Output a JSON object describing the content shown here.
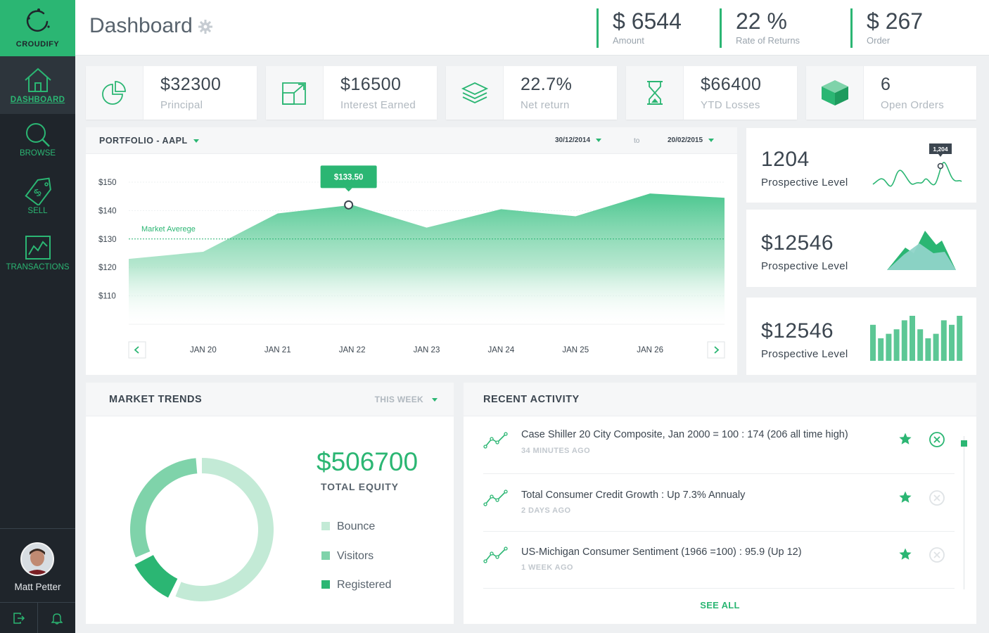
{
  "app": {
    "brand": "CROUDIFY"
  },
  "sidebar": {
    "items": [
      {
        "label": "DASHBOARD",
        "icon": "home-icon",
        "active": true
      },
      {
        "label": "BROWSE",
        "icon": "search-icon"
      },
      {
        "label": "SELL",
        "icon": "dollar-tag-icon"
      },
      {
        "label": "TRANSACTIONS",
        "icon": "chart-icon"
      }
    ],
    "user": {
      "name": "Matt Petter"
    }
  },
  "header": {
    "title": "Dashboard",
    "stats": [
      {
        "value": "$ 6544",
        "label": "Amount"
      },
      {
        "value": "22 %",
        "label": "Rate of Returns"
      },
      {
        "value": "$ 267",
        "label": "Order"
      }
    ]
  },
  "stat_cards": [
    {
      "value": "$32300",
      "label": "Principal",
      "icon": "pie-chart-icon"
    },
    {
      "value": "$16500",
      "label": "Interest Earned",
      "icon": "expand-arrow-icon"
    },
    {
      "value": "22.7%",
      "label": "Net return",
      "icon": "layers-icon"
    },
    {
      "value": "$66400",
      "label": "YTD Losses",
      "icon": "hourglass-icon"
    },
    {
      "value": "6",
      "label": "Open Orders",
      "icon": "box-icon"
    }
  ],
  "portfolio": {
    "title": "PORTFOLIO - AAPL",
    "date_from": "30/12/2014",
    "date_to_label": "to",
    "date_to": "20/02/2015",
    "market_average_label": "Market Averege",
    "tooltip": "$133.50"
  },
  "mini_cards": [
    {
      "value": "1204",
      "label": "Prospective Level",
      "badge": "1,204"
    },
    {
      "value": "$12546",
      "label": "Prospective Level"
    },
    {
      "value": "$12546",
      "label": "Prospective Level",
      "bars": [
        8,
        5,
        6,
        7,
        9,
        10,
        7,
        5,
        6,
        9,
        8,
        10
      ]
    }
  ],
  "market_trends": {
    "title": "MARKET TRENDS",
    "filter": "THIS WEEK",
    "equity_value": "$506700",
    "equity_label": "TOTAL EQUITY",
    "legend": [
      {
        "label": "Bounce",
        "color": "#c3ead6"
      },
      {
        "label": "Visitors",
        "color": "#7fd3aa"
      },
      {
        "label": "Registered",
        "color": "#2bb673"
      }
    ],
    "donut": [
      {
        "label": "Bounce",
        "value": 56
      },
      {
        "label": "Registered",
        "value": 10
      },
      {
        "label": "Visitors",
        "value": 30
      }
    ]
  },
  "recent_activity": {
    "title": "RECENT ACTIVITY",
    "items": [
      {
        "text": "Case Shiller 20 City Composite, Jan 2000 = 100 :    174 (206 all time high)",
        "time": "34 MINUTES AGO"
      },
      {
        "text": "Total Consumer Credit Growth :    Up 7.3% Annualy",
        "time": "2 DAYS AGO"
      },
      {
        "text": "US-Michigan Consumer Sentiment (1966 =100) :    95.9 (Up 12)",
        "time": "1 WEEK AGO"
      }
    ],
    "see_all": "SEE ALL"
  },
  "colors": {
    "accent": "#2bb673",
    "sidebar": "#1f252b",
    "light_green": "#c3ead6"
  },
  "chart_data": {
    "type": "area",
    "categories": [
      "",
      "JAN 20",
      "JAN 21",
      "JAN 22",
      "JAN 23",
      "JAN 24",
      "JAN 25",
      "JAN 26",
      ""
    ],
    "values": [
      123,
      125.5,
      139,
      142,
      134,
      140.5,
      138,
      146,
      144.5
    ],
    "y_ticks": [
      "$150",
      "$140",
      "$130",
      "$120",
      "$110"
    ],
    "ylim": [
      100,
      150
    ],
    "market_average": 130,
    "highlight": {
      "category": "JAN 22",
      "value": 133.5
    }
  }
}
